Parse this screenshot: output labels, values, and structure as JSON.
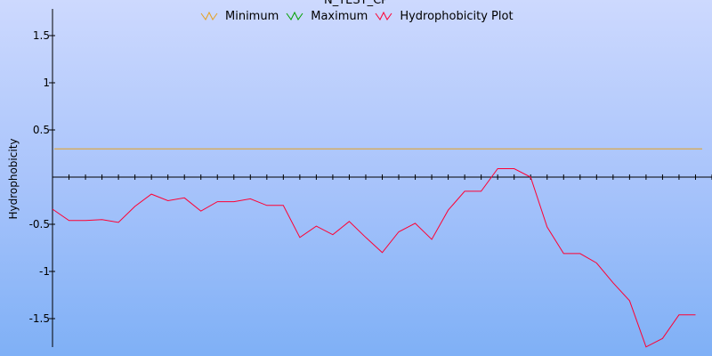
{
  "chart_data": {
    "type": "line",
    "title": "N_TEST_CP",
    "ylabel": "Hydrophobicity",
    "xlabel": "",
    "ylim": [
      -1.8,
      1.8
    ],
    "yticks": [
      "1.5",
      "1",
      "0.5",
      "-0.5",
      "-1",
      "-1.5"
    ],
    "ytick_values": [
      1.5,
      1,
      0.5,
      -0.5,
      -1,
      -1.5
    ],
    "grid": false,
    "legend_position": "top-center",
    "series": [
      {
        "name": "Minimum",
        "color": "#e6a020",
        "values": [
          0.3
        ]
      },
      {
        "name": "Maximum",
        "color": "#00a000",
        "values": []
      },
      {
        "name": "Hydrophobicity Plot",
        "color": "#ff0033",
        "values": [
          -0.34,
          -0.46,
          -0.46,
          -0.45,
          -0.48,
          -0.31,
          -0.18,
          -0.25,
          -0.22,
          -0.36,
          -0.26,
          -0.26,
          -0.23,
          -0.3,
          -0.3,
          -0.64,
          -0.52,
          -0.61,
          -0.47,
          -0.64,
          -0.8,
          -0.58,
          -0.49,
          -0.66,
          -0.35,
          -0.15,
          -0.15,
          0.09,
          0.09,
          0.0,
          -0.53,
          -0.81,
          -0.81,
          -0.91,
          -1.12,
          -1.31,
          -1.8,
          -1.71,
          -1.46,
          -1.46
        ]
      }
    ]
  }
}
